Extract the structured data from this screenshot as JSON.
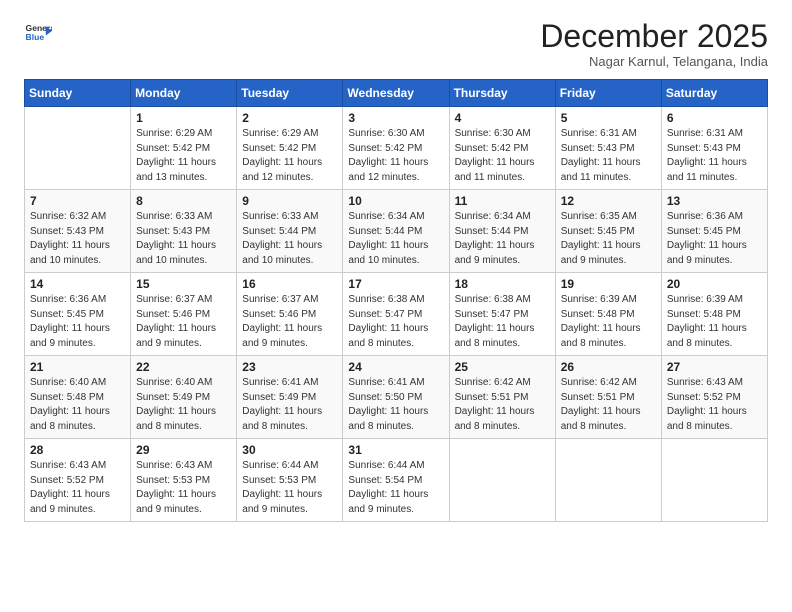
{
  "logo": {
    "line1": "General",
    "line2": "Blue"
  },
  "title": "December 2025",
  "location": "Nagar Karnul, Telangana, India",
  "weekdays": [
    "Sunday",
    "Monday",
    "Tuesday",
    "Wednesday",
    "Thursday",
    "Friday",
    "Saturday"
  ],
  "weeks": [
    [
      {
        "num": "",
        "info": ""
      },
      {
        "num": "1",
        "info": "Sunrise: 6:29 AM\nSunset: 5:42 PM\nDaylight: 11 hours\nand 13 minutes."
      },
      {
        "num": "2",
        "info": "Sunrise: 6:29 AM\nSunset: 5:42 PM\nDaylight: 11 hours\nand 12 minutes."
      },
      {
        "num": "3",
        "info": "Sunrise: 6:30 AM\nSunset: 5:42 PM\nDaylight: 11 hours\nand 12 minutes."
      },
      {
        "num": "4",
        "info": "Sunrise: 6:30 AM\nSunset: 5:42 PM\nDaylight: 11 hours\nand 11 minutes."
      },
      {
        "num": "5",
        "info": "Sunrise: 6:31 AM\nSunset: 5:43 PM\nDaylight: 11 hours\nand 11 minutes."
      },
      {
        "num": "6",
        "info": "Sunrise: 6:31 AM\nSunset: 5:43 PM\nDaylight: 11 hours\nand 11 minutes."
      }
    ],
    [
      {
        "num": "7",
        "info": "Sunrise: 6:32 AM\nSunset: 5:43 PM\nDaylight: 11 hours\nand 10 minutes."
      },
      {
        "num": "8",
        "info": "Sunrise: 6:33 AM\nSunset: 5:43 PM\nDaylight: 11 hours\nand 10 minutes."
      },
      {
        "num": "9",
        "info": "Sunrise: 6:33 AM\nSunset: 5:44 PM\nDaylight: 11 hours\nand 10 minutes."
      },
      {
        "num": "10",
        "info": "Sunrise: 6:34 AM\nSunset: 5:44 PM\nDaylight: 11 hours\nand 10 minutes."
      },
      {
        "num": "11",
        "info": "Sunrise: 6:34 AM\nSunset: 5:44 PM\nDaylight: 11 hours\nand 9 minutes."
      },
      {
        "num": "12",
        "info": "Sunrise: 6:35 AM\nSunset: 5:45 PM\nDaylight: 11 hours\nand 9 minutes."
      },
      {
        "num": "13",
        "info": "Sunrise: 6:36 AM\nSunset: 5:45 PM\nDaylight: 11 hours\nand 9 minutes."
      }
    ],
    [
      {
        "num": "14",
        "info": "Sunrise: 6:36 AM\nSunset: 5:45 PM\nDaylight: 11 hours\nand 9 minutes."
      },
      {
        "num": "15",
        "info": "Sunrise: 6:37 AM\nSunset: 5:46 PM\nDaylight: 11 hours\nand 9 minutes."
      },
      {
        "num": "16",
        "info": "Sunrise: 6:37 AM\nSunset: 5:46 PM\nDaylight: 11 hours\nand 9 minutes."
      },
      {
        "num": "17",
        "info": "Sunrise: 6:38 AM\nSunset: 5:47 PM\nDaylight: 11 hours\nand 8 minutes."
      },
      {
        "num": "18",
        "info": "Sunrise: 6:38 AM\nSunset: 5:47 PM\nDaylight: 11 hours\nand 8 minutes."
      },
      {
        "num": "19",
        "info": "Sunrise: 6:39 AM\nSunset: 5:48 PM\nDaylight: 11 hours\nand 8 minutes."
      },
      {
        "num": "20",
        "info": "Sunrise: 6:39 AM\nSunset: 5:48 PM\nDaylight: 11 hours\nand 8 minutes."
      }
    ],
    [
      {
        "num": "21",
        "info": "Sunrise: 6:40 AM\nSunset: 5:48 PM\nDaylight: 11 hours\nand 8 minutes."
      },
      {
        "num": "22",
        "info": "Sunrise: 6:40 AM\nSunset: 5:49 PM\nDaylight: 11 hours\nand 8 minutes."
      },
      {
        "num": "23",
        "info": "Sunrise: 6:41 AM\nSunset: 5:49 PM\nDaylight: 11 hours\nand 8 minutes."
      },
      {
        "num": "24",
        "info": "Sunrise: 6:41 AM\nSunset: 5:50 PM\nDaylight: 11 hours\nand 8 minutes."
      },
      {
        "num": "25",
        "info": "Sunrise: 6:42 AM\nSunset: 5:51 PM\nDaylight: 11 hours\nand 8 minutes."
      },
      {
        "num": "26",
        "info": "Sunrise: 6:42 AM\nSunset: 5:51 PM\nDaylight: 11 hours\nand 8 minutes."
      },
      {
        "num": "27",
        "info": "Sunrise: 6:43 AM\nSunset: 5:52 PM\nDaylight: 11 hours\nand 8 minutes."
      }
    ],
    [
      {
        "num": "28",
        "info": "Sunrise: 6:43 AM\nSunset: 5:52 PM\nDaylight: 11 hours\nand 9 minutes."
      },
      {
        "num": "29",
        "info": "Sunrise: 6:43 AM\nSunset: 5:53 PM\nDaylight: 11 hours\nand 9 minutes."
      },
      {
        "num": "30",
        "info": "Sunrise: 6:44 AM\nSunset: 5:53 PM\nDaylight: 11 hours\nand 9 minutes."
      },
      {
        "num": "31",
        "info": "Sunrise: 6:44 AM\nSunset: 5:54 PM\nDaylight: 11 hours\nand 9 minutes."
      },
      {
        "num": "",
        "info": ""
      },
      {
        "num": "",
        "info": ""
      },
      {
        "num": "",
        "info": ""
      }
    ]
  ]
}
